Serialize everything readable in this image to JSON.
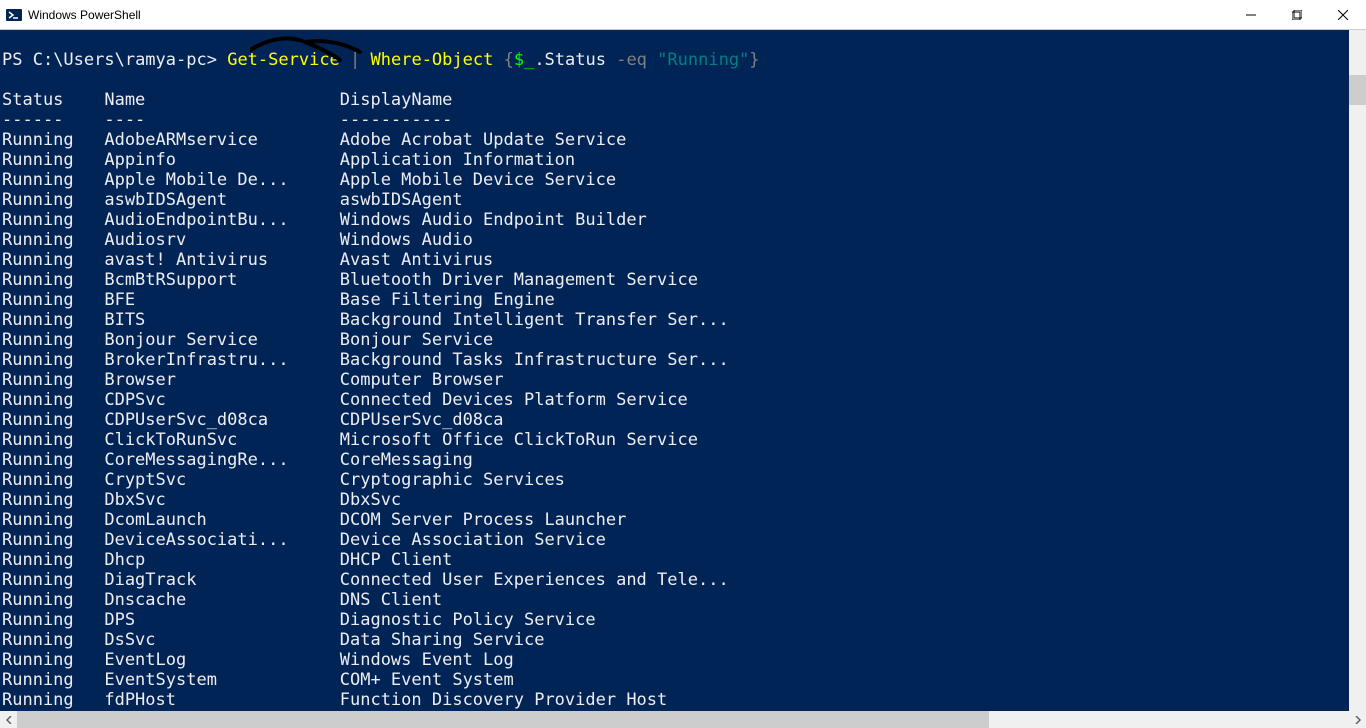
{
  "titlebar": {
    "title": "Windows PowerShell"
  },
  "prompt": {
    "ps": "PS ",
    "path": "C:\\Users\\ramya-pc>",
    "sp": " ",
    "cmd1": "Get-Service",
    "pipe": " | ",
    "cmd2": "Where-Object",
    "brace_open": " {",
    "dollar_underscore": "$_",
    "dot_status": ".Status ",
    "eq": "-eq",
    "sp2": " ",
    "str": "\"Running\"",
    "brace_close": "}"
  },
  "headers": {
    "status": "Status",
    "name": "Name",
    "display": "DisplayName"
  },
  "underlines": {
    "status": "------",
    "name": "----",
    "display": "-----------"
  },
  "services": [
    {
      "status": "Running",
      "name": "AdobeARMservice",
      "display": "Adobe Acrobat Update Service"
    },
    {
      "status": "Running",
      "name": "Appinfo",
      "display": "Application Information"
    },
    {
      "status": "Running",
      "name": "Apple Mobile De...",
      "display": "Apple Mobile Device Service"
    },
    {
      "status": "Running",
      "name": "aswbIDSAgent",
      "display": "aswbIDSAgent"
    },
    {
      "status": "Running",
      "name": "AudioEndpointBu...",
      "display": "Windows Audio Endpoint Builder"
    },
    {
      "status": "Running",
      "name": "Audiosrv",
      "display": "Windows Audio"
    },
    {
      "status": "Running",
      "name": "avast! Antivirus",
      "display": "Avast Antivirus"
    },
    {
      "status": "Running",
      "name": "BcmBtRSupport",
      "display": "Bluetooth Driver Management Service"
    },
    {
      "status": "Running",
      "name": "BFE",
      "display": "Base Filtering Engine"
    },
    {
      "status": "Running",
      "name": "BITS",
      "display": "Background Intelligent Transfer Ser..."
    },
    {
      "status": "Running",
      "name": "Bonjour Service",
      "display": "Bonjour Service"
    },
    {
      "status": "Running",
      "name": "BrokerInfrastru...",
      "display": "Background Tasks Infrastructure Ser..."
    },
    {
      "status": "Running",
      "name": "Browser",
      "display": "Computer Browser"
    },
    {
      "status": "Running",
      "name": "CDPSvc",
      "display": "Connected Devices Platform Service"
    },
    {
      "status": "Running",
      "name": "CDPUserSvc_d08ca",
      "display": "CDPUserSvc_d08ca"
    },
    {
      "status": "Running",
      "name": "ClickToRunSvc",
      "display": "Microsoft Office ClickToRun Service"
    },
    {
      "status": "Running",
      "name": "CoreMessagingRe...",
      "display": "CoreMessaging"
    },
    {
      "status": "Running",
      "name": "CryptSvc",
      "display": "Cryptographic Services"
    },
    {
      "status": "Running",
      "name": "DbxSvc",
      "display": "DbxSvc"
    },
    {
      "status": "Running",
      "name": "DcomLaunch",
      "display": "DCOM Server Process Launcher"
    },
    {
      "status": "Running",
      "name": "DeviceAssociati...",
      "display": "Device Association Service"
    },
    {
      "status": "Running",
      "name": "Dhcp",
      "display": "DHCP Client"
    },
    {
      "status": "Running",
      "name": "DiagTrack",
      "display": "Connected User Experiences and Tele..."
    },
    {
      "status": "Running",
      "name": "Dnscache",
      "display": "DNS Client"
    },
    {
      "status": "Running",
      "name": "DPS",
      "display": "Diagnostic Policy Service"
    },
    {
      "status": "Running",
      "name": "DsSvc",
      "display": "Data Sharing Service"
    },
    {
      "status": "Running",
      "name": "EventLog",
      "display": "Windows Event Log"
    },
    {
      "status": "Running",
      "name": "EventSystem",
      "display": "COM+ Event System"
    },
    {
      "status": "Running",
      "name": "fdPHost",
      "display": "Function Discovery Provider Host"
    }
  ],
  "columns": {
    "status_width": 9,
    "name_width": 22
  }
}
